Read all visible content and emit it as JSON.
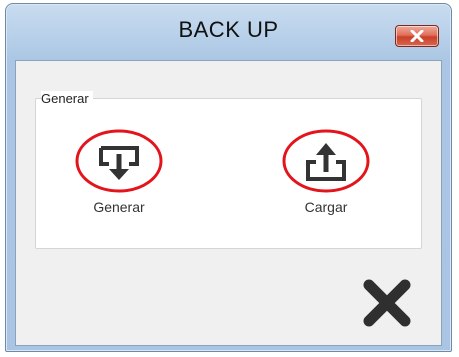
{
  "window": {
    "title": "BACK UP",
    "close_icon": "close-x-icon"
  },
  "group": {
    "label": "Generar"
  },
  "actions": [
    {
      "label": "Generar",
      "icon": "download-to-tray-icon",
      "highlighted": true
    },
    {
      "label": "Cargar",
      "icon": "upload-from-tray-icon",
      "highlighted": true
    }
  ],
  "exit": {
    "icon": "big-x-icon"
  },
  "colors": {
    "highlight_circle": "#e3141b",
    "icon_dark": "#333333",
    "titlebar": "#b9d1ea",
    "close_button": "#d8674c"
  }
}
